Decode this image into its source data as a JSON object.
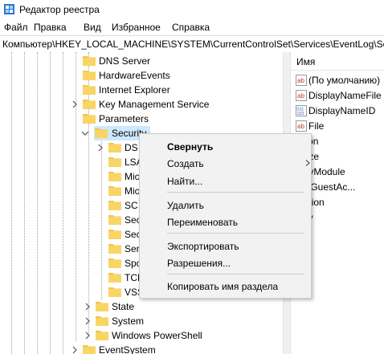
{
  "window": {
    "title": "Редактор реестра"
  },
  "menu": [
    "Файл",
    "Правка",
    "Вид",
    "Избранное",
    "Справка"
  ],
  "address": "Компьютер\\HKEY_LOCAL_MACHINE\\SYSTEM\\CurrentControlSet\\Services\\EventLog\\Sec",
  "tree": {
    "items": [
      {
        "label": "DNS Server"
      },
      {
        "label": "HardwareEvents"
      },
      {
        "label": "Internet Explorer"
      },
      {
        "label": "Key Management Service"
      },
      {
        "label": "Parameters"
      },
      {
        "label": "Security"
      },
      {
        "label": "DS"
      },
      {
        "label": "LSA"
      },
      {
        "label": "Mic"
      },
      {
        "label": "Mic"
      },
      {
        "label": "SC"
      },
      {
        "label": "Sec"
      },
      {
        "label": "Sec"
      },
      {
        "label": "Serv"
      },
      {
        "label": "Spo"
      },
      {
        "label": "TCP"
      },
      {
        "label": "VSS"
      },
      {
        "label": "State"
      },
      {
        "label": "System"
      },
      {
        "label": "Windows PowerShell"
      },
      {
        "label": "EventSystem"
      }
    ]
  },
  "values": {
    "header": "Имя",
    "rows": [
      {
        "label": "(По умолчанию)",
        "icon": "string-value-icon"
      },
      {
        "label": "DisplayNameFile",
        "icon": "string-value-icon"
      },
      {
        "label": "DisplayNameID",
        "icon": "binary-value-icon"
      },
      {
        "label": "File",
        "icon": "string-value-icon"
      },
      {
        "label": "olation",
        "icon": ""
      },
      {
        "label": "axSize",
        "icon": ""
      },
      {
        "label": "imaryModule",
        "icon": ""
      },
      {
        "label": "strictGuestAc...",
        "icon": ""
      },
      {
        "label": "etention",
        "icon": ""
      },
      {
        "label": "curity",
        "icon": ""
      }
    ]
  },
  "context_menu": {
    "collapse": "Свернуть",
    "create": "Создать",
    "find": "Найти...",
    "delete": "Удалить",
    "rename": "Переименовать",
    "export": "Экспортировать",
    "permissions": "Разрешения...",
    "copy_key_name": "Копировать имя раздела"
  },
  "colors": {
    "folder": "#f5c542",
    "selection": "#cde8ff",
    "menu_bg": "#f2f2f2",
    "value_icon_red": "#c0392b",
    "value_icon_blue": "#2a5db0"
  }
}
